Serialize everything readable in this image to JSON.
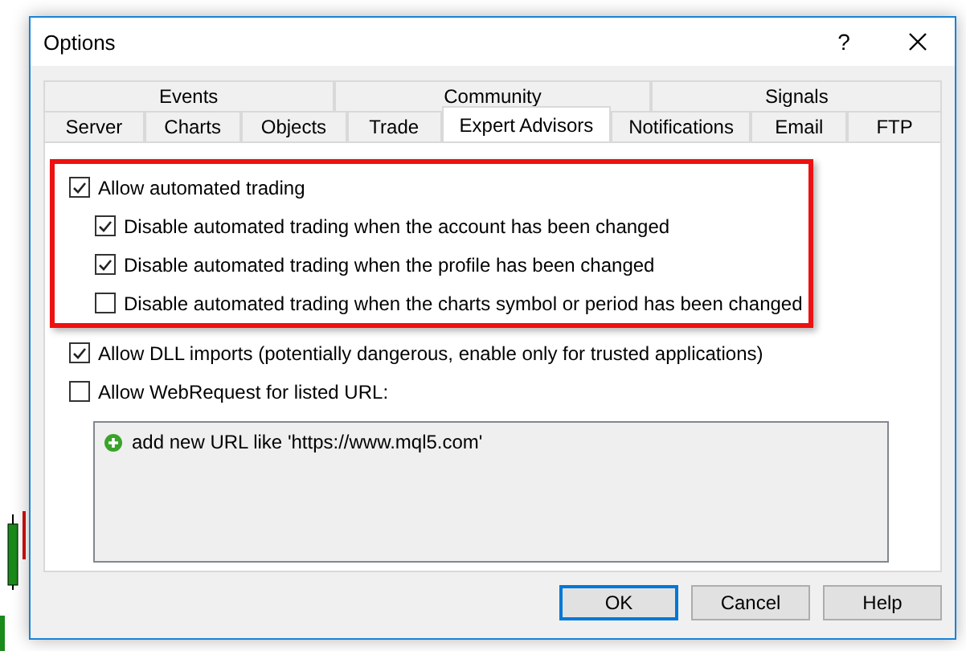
{
  "window": {
    "title": "Options",
    "help": "?"
  },
  "tab_rows": [
    [
      {
        "label": "Events",
        "selected": false
      },
      {
        "label": "Community",
        "selected": false
      },
      {
        "label": "Signals",
        "selected": false
      }
    ],
    [
      {
        "label": "Server",
        "selected": false
      },
      {
        "label": "Charts",
        "selected": false
      },
      {
        "label": "Objects",
        "selected": false
      },
      {
        "label": "Trade",
        "selected": false
      },
      {
        "label": "Expert Advisors",
        "selected": true
      },
      {
        "label": "Notifications",
        "selected": false
      },
      {
        "label": "Email",
        "selected": false
      },
      {
        "label": "FTP",
        "selected": false
      }
    ]
  ],
  "highlighted_group": {
    "label": "Allow automated trading",
    "checked": true,
    "children": [
      {
        "label": "Disable automated trading when the account has been changed",
        "checked": true
      },
      {
        "label": "Disable automated trading when the profile has been changed",
        "checked": true
      },
      {
        "label": "Disable automated trading when the charts symbol or period has been changed",
        "checked": false
      }
    ]
  },
  "options": [
    {
      "label": "Allow DLL imports (potentially dangerous, enable only for trusted applications)",
      "checked": true
    },
    {
      "label": "Allow WebRequest for listed URL:",
      "checked": false
    }
  ],
  "url_list": {
    "items": [
      {
        "label": "add new URL like 'https://www.mql5.com'"
      }
    ]
  },
  "buttons": [
    {
      "label": "OK",
      "default": true
    },
    {
      "label": "Cancel",
      "default": false
    },
    {
      "label": "Help",
      "default": false
    }
  ]
}
